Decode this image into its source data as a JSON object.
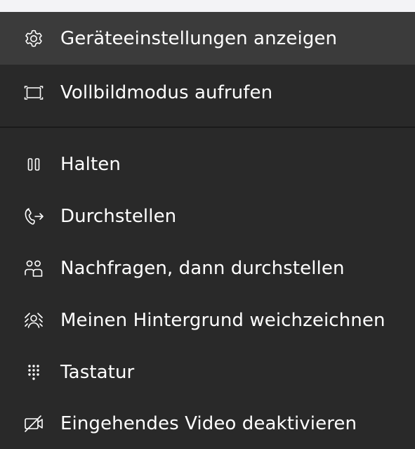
{
  "menu": {
    "items": [
      {
        "label": "Geräteeinstellungen anzeigen",
        "icon": "gear-icon"
      },
      {
        "label": "Vollbildmodus aufrufen",
        "icon": "fullscreen-icon"
      },
      {
        "label": "Halten",
        "icon": "pause-icon"
      },
      {
        "label": "Durchstellen",
        "icon": "call-transfer-icon"
      },
      {
        "label": "Nachfragen, dann durchstellen",
        "icon": "consult-transfer-icon"
      },
      {
        "label": "Meinen Hintergrund weichzeichnen",
        "icon": "blur-background-icon"
      },
      {
        "label": "Tastatur",
        "icon": "dialpad-icon"
      },
      {
        "label": "Eingehendes Video deaktivieren",
        "icon": "video-off-icon"
      }
    ]
  },
  "colors": {
    "menu_background": "#292929",
    "highlight_background": "#3b3b3b",
    "text": "#ffffff",
    "page_background": "#f3f3f6"
  }
}
